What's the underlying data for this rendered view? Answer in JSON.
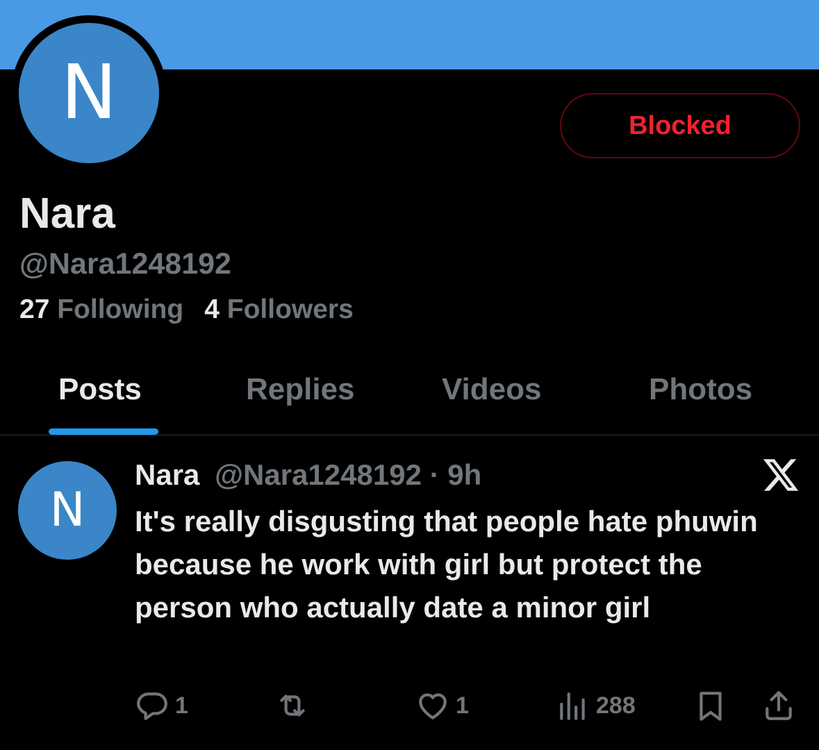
{
  "colors": {
    "banner": "#4a99e5",
    "avatar": "#3a86c8",
    "accent": "#1d9bf0",
    "blocked_text": "#f4212e",
    "muted": "#71767b"
  },
  "profile": {
    "avatar_letter": "N",
    "blocked_label": "Blocked",
    "name": "Nara",
    "handle": "@Nara1248192",
    "following_count": "27",
    "following_label": "Following",
    "followers_count": "4",
    "followers_label": "Followers"
  },
  "tabs": [
    {
      "label": "Posts",
      "active": true
    },
    {
      "label": "Replies",
      "active": false
    },
    {
      "label": "Videos",
      "active": false
    },
    {
      "label": "Photos",
      "active": false
    }
  ],
  "post": {
    "avatar_letter": "N",
    "name": "Nara",
    "handle": "@Nara1248192",
    "dot": "·",
    "time": "9h",
    "source_icon": "x-logo-icon",
    "text": "It's really disgusting that people hate phuwin because he work with girl but protect the person who actually date a minor girl",
    "actions": {
      "replies": "1",
      "reposts": "",
      "likes": "1",
      "views": "288"
    }
  }
}
